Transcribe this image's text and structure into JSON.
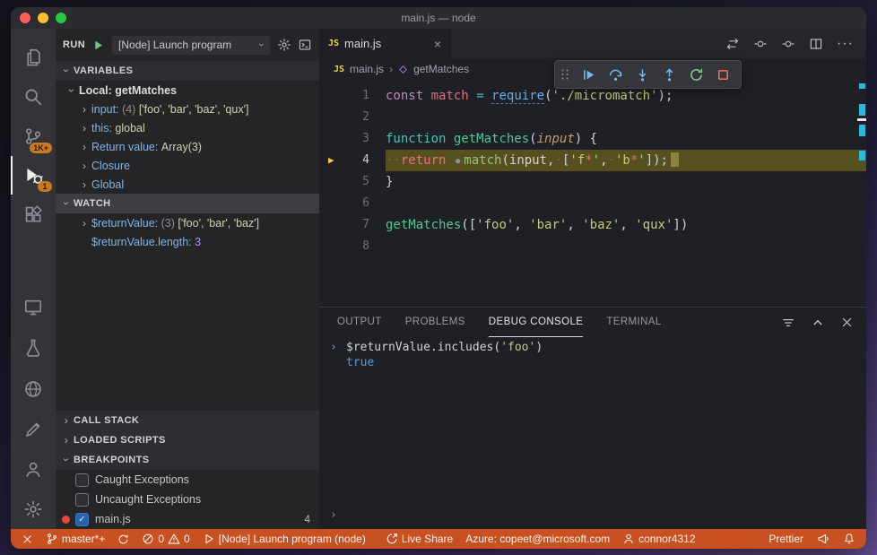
{
  "titlebar": {
    "title": "main.js — node"
  },
  "activity_bar": {
    "scm_badge": "1K+",
    "debug_badge": "1"
  },
  "run_panel": {
    "run_label": "RUN",
    "config_name": "[Node] Launch program",
    "variables": {
      "title": "VARIABLES",
      "scope_label": "Local: getMatches",
      "items": [
        {
          "expand": true,
          "name": "input:",
          "count": "(4)",
          "value": "['foo', 'bar', 'baz', 'qux']"
        },
        {
          "expand": true,
          "name": "this:",
          "value": "global"
        },
        {
          "expand": true,
          "name": "Return value:",
          "value": "Array(3)"
        },
        {
          "expand": true,
          "name": "Closure"
        },
        {
          "expand": true,
          "name": "Global"
        }
      ]
    },
    "watch": {
      "title": "WATCH",
      "items": [
        {
          "expand": true,
          "name": "$returnValue:",
          "count": "(3)",
          "value": "['foo', 'bar', 'baz']"
        },
        {
          "name": "$returnValue.length:",
          "value": "3",
          "kind": "number"
        }
      ]
    },
    "call_stack_title": "CALL STACK",
    "loaded_scripts_title": "LOADED SCRIPTS",
    "breakpoints": {
      "title": "BREAKPOINTS",
      "items": [
        {
          "label": "Caught Exceptions",
          "checked": false
        },
        {
          "label": "Uncaught Exceptions",
          "checked": false
        },
        {
          "label": "main.js",
          "checked": true,
          "dot": true,
          "line": "4"
        }
      ]
    }
  },
  "editor": {
    "tab_label": "main.js",
    "tab_icon": "JS",
    "breadcrumbs": {
      "file_icon": "JS",
      "file": "main.js",
      "symbol": "getMatches"
    },
    "code_lines": [
      {
        "num": "1",
        "tokens": [
          [
            "kw",
            "const"
          ],
          [
            "pl",
            " "
          ],
          [
            "var",
            "match"
          ],
          [
            "pl",
            " "
          ],
          [
            "op",
            "="
          ],
          [
            "pl",
            " "
          ],
          [
            "req",
            "require"
          ],
          [
            "punc",
            "("
          ],
          [
            "str",
            "'./micromatch'"
          ],
          [
            "punc",
            ");"
          ]
        ]
      },
      {
        "num": "2",
        "tokens": []
      },
      {
        "num": "3",
        "tokens": [
          [
            "fnkw",
            "function"
          ],
          [
            "pl",
            " "
          ],
          [
            "fn",
            "getMatches"
          ],
          [
            "punc",
            "("
          ],
          [
            "param",
            "input"
          ],
          [
            "punc",
            ")"
          ],
          [
            "pl",
            " "
          ],
          [
            "punc",
            "{"
          ]
        ]
      },
      {
        "num": "4",
        "current": true,
        "end_block": true,
        "tokens": [
          [
            "ws",
            "··"
          ],
          [
            "ret",
            "return"
          ],
          [
            "pl",
            " "
          ],
          [
            "bp",
            ""
          ],
          [
            "call",
            "match"
          ],
          [
            "punc",
            "("
          ],
          [
            "pl",
            "input"
          ],
          [
            "punc",
            ","
          ],
          [
            "ws",
            "·"
          ],
          [
            "punc",
            "["
          ],
          [
            "str",
            "'f"
          ],
          [
            "strx",
            "*"
          ],
          [
            "str",
            "'"
          ],
          [
            "punc",
            ","
          ],
          [
            "ws",
            "·"
          ],
          [
            "str",
            "'b"
          ],
          [
            "strx",
            "*"
          ],
          [
            "str",
            "'"
          ],
          [
            "punc",
            "]);"
          ]
        ]
      },
      {
        "num": "5",
        "tokens": [
          [
            "punc",
            "}"
          ]
        ]
      },
      {
        "num": "6",
        "tokens": []
      },
      {
        "num": "7",
        "tokens": [
          [
            "fn",
            "getMatches"
          ],
          [
            "punc",
            "(["
          ],
          [
            "str",
            "'foo'"
          ],
          [
            "punc",
            ","
          ],
          [
            "pl",
            " "
          ],
          [
            "str",
            "'bar'"
          ],
          [
            "punc",
            ","
          ],
          [
            "pl",
            " "
          ],
          [
            "str",
            "'baz'"
          ],
          [
            "punc",
            ","
          ],
          [
            "pl",
            " "
          ],
          [
            "str",
            "'qux'"
          ],
          [
            "punc",
            "])"
          ]
        ]
      },
      {
        "num": "8",
        "tokens": []
      }
    ]
  },
  "panel": {
    "tabs": [
      "OUTPUT",
      "PROBLEMS",
      "DEBUG CONSOLE",
      "TERMINAL"
    ],
    "console": {
      "input_tokens": [
        [
          "pl",
          "$returnValue.includes("
        ],
        [
          "cstr",
          "'foo'"
        ],
        [
          "pl",
          ")"
        ]
      ],
      "output": "true"
    }
  },
  "status_bar": {
    "branch": "master*+",
    "errors": "0",
    "warnings": "0",
    "launch": "[Node] Launch program (node)",
    "live_share": "Live Share",
    "azure": "Azure: copeet@microsoft.com",
    "account": "connor4312",
    "formatter": "Prettier"
  }
}
